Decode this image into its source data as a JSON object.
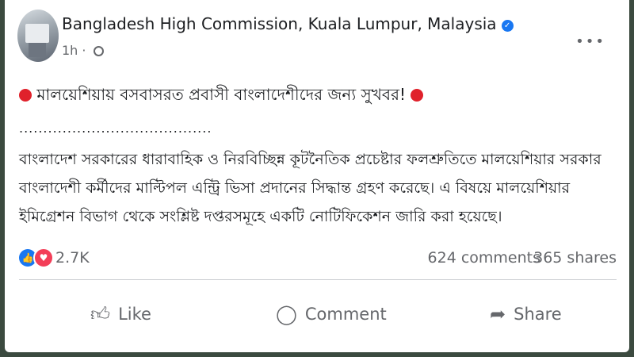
{
  "post": {
    "page_name": "Bangladesh High Commission, Kuala Lumpur, Malaysia",
    "time": "1h",
    "headline": "মালয়েশিয়ায় বসবাসরত প্রবাসী বাংলাদেশীদের জন্য সুখবর!",
    "separator": "........................................",
    "body_lines": [
      "বাংলাদেশ সরকারের ধারাবাহিক ও নিরবিচ্ছিন্ন কূটনৈতিক প্রচেষ্টার ফলশ্রুতিতে মালয়েশিয়ার সরকার",
      "বাংলাদেশী কর্মীদের মাল্টিপল এন্ট্রি ভিসা প্রদানের সিদ্ধান্ত গ্রহণ করেছে। এ বিষয়ে মালয়েশিয়ার",
      "ইমিগ্রেশন বিভাগ থেকে সংশ্লিষ্ট দপ্তরসমূহে একটি নোটিফিকেশন জারি করা হয়েছে।"
    ]
  },
  "stats": {
    "reactions": "2.7K",
    "comments": "624 comments",
    "shares": "365 shares"
  },
  "actions": {
    "like": "Like",
    "comment": "Comment",
    "share": "Share"
  },
  "colors": {
    "accent": "#1877f2",
    "red_dot": "#e0212b",
    "love": "#f33e58"
  }
}
